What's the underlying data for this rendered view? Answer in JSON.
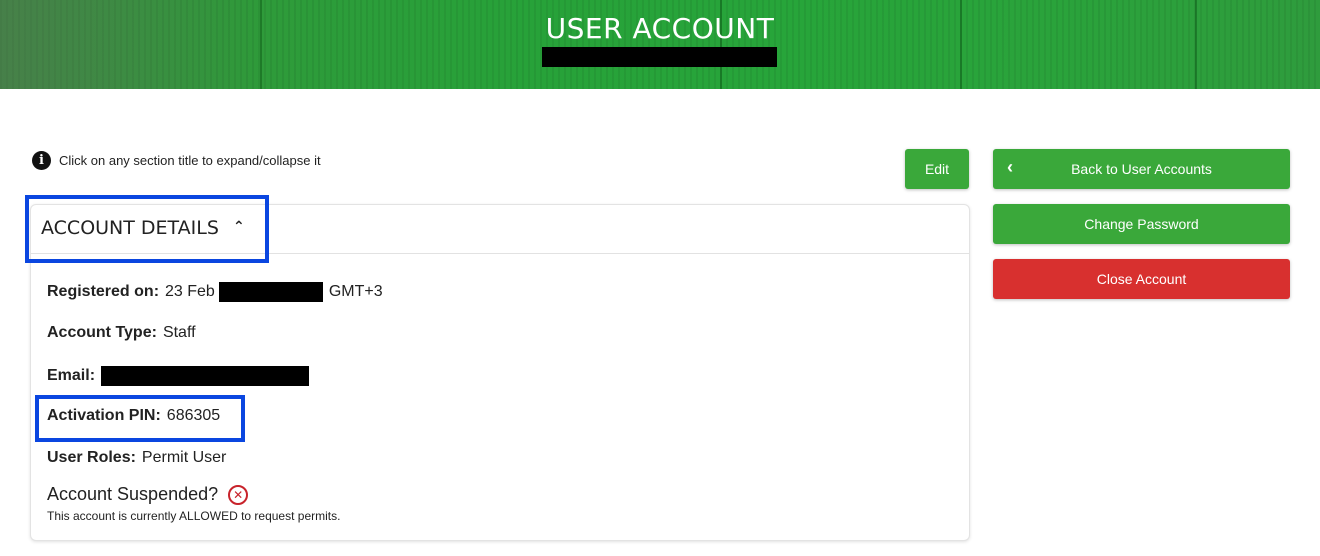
{
  "header": {
    "title": "USER ACCOUNT"
  },
  "info": {
    "icon": "info-icon",
    "text": "Click on any section title to expand/collapse it"
  },
  "actions": {
    "edit_label": "Edit",
    "back_label": "Back to User Accounts",
    "change_password_label": "Change Password",
    "close_account_label": "Close Account"
  },
  "colors": {
    "primary_green": "#3aa83a",
    "danger_red": "#d8302f",
    "highlight_blue": "#0a46e0"
  },
  "account_details": {
    "section_title": "ACCOUNT DETAILS",
    "registered_label": "Registered on:",
    "registered_date_prefix": "23 Feb",
    "registered_tz": "GMT+3",
    "account_type_label": "Account Type:",
    "account_type_value": "Staff",
    "email_label": "Email:",
    "activation_pin_label": "Activation PIN:",
    "activation_pin_value": "686305",
    "user_roles_label": "User Roles:",
    "user_roles_value": "Permit User",
    "suspended_label": "Account Suspended?",
    "suspended_note": "This account is currently ALLOWED to request permits."
  }
}
